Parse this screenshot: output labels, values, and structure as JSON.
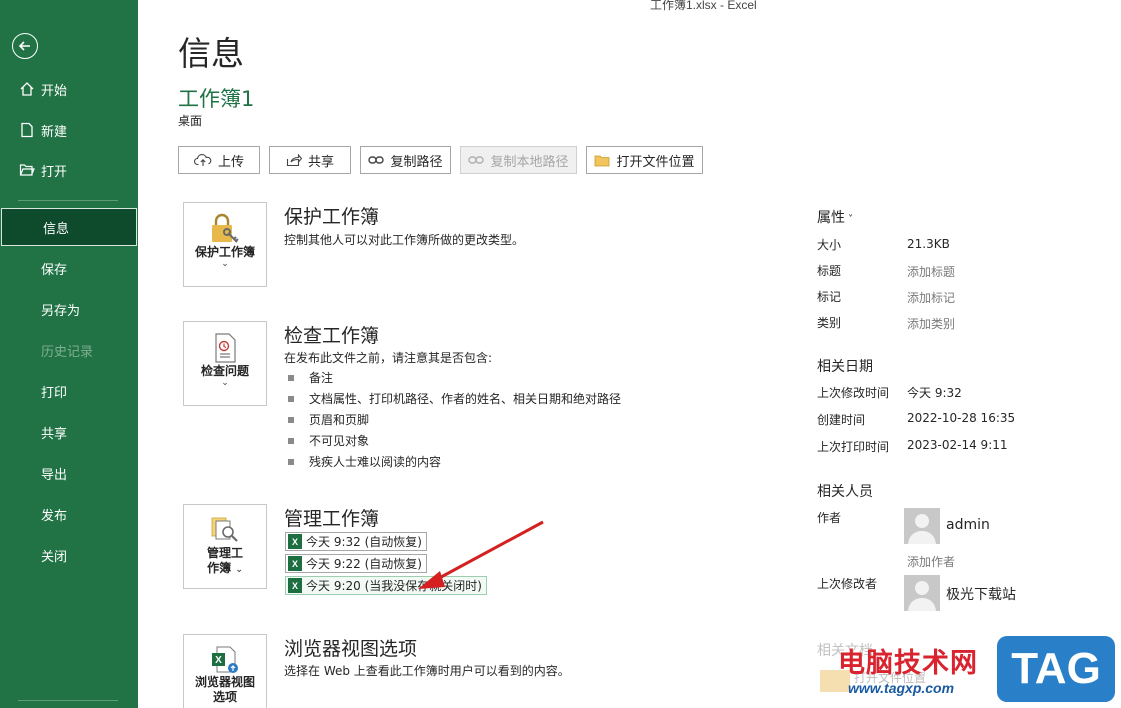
{
  "window": {
    "title": "工作簿1.xlsx  -  Excel"
  },
  "sidebar": {
    "items": [
      {
        "label": "开始",
        "icon": "home-icon"
      },
      {
        "label": "新建",
        "icon": "new-document-icon"
      },
      {
        "label": "打开",
        "icon": "open-folder-icon"
      },
      {
        "label": "信息",
        "active": true
      },
      {
        "label": "保存"
      },
      {
        "label": "另存为"
      },
      {
        "label": "历史记录",
        "disabled": true
      },
      {
        "label": "打印"
      },
      {
        "label": "共享"
      },
      {
        "label": "导出"
      },
      {
        "label": "发布"
      },
      {
        "label": "关闭"
      }
    ]
  },
  "page": {
    "title": "信息",
    "workbook_name": "工作簿1",
    "location": "桌面"
  },
  "actions": {
    "upload": "上传",
    "share": "共享",
    "copy_path": "复制路径",
    "copy_local_path": "复制本地路径",
    "open_location": "打开文件位置"
  },
  "protect": {
    "card_label": "保护工作簿",
    "title": "保护工作簿",
    "desc": "控制其他人可以对此工作簿所做的更改类型。"
  },
  "inspect": {
    "card_label": "检查问题",
    "title": "检查工作簿",
    "desc": "在发布此文件之前，请注意其是否包含:",
    "bullets": [
      "备注",
      "文档属性、打印机路径、作者的姓名、相关日期和绝对路径",
      "页眉和页脚",
      "不可见对象",
      "残疾人士难以阅读的内容"
    ]
  },
  "manage": {
    "card_label_1": "管理工",
    "card_label_2": "作簿",
    "title": "管理工作簿",
    "versions": [
      "今天 9:32 (自动恢复)",
      "今天 9:22 (自动恢复)",
      "今天 9:20 (当我没保存就关闭时)"
    ]
  },
  "browser": {
    "card_label_1": "浏览器视图",
    "card_label_2": "选项",
    "title": "浏览器视图选项",
    "desc": "选择在 Web 上查看此工作簿时用户可以看到的内容。"
  },
  "properties": {
    "heading": "属性",
    "rows": [
      {
        "label": "大小",
        "value": "21.3KB"
      },
      {
        "label": "标题",
        "value": "添加标题"
      },
      {
        "label": "标记",
        "value": "添加标记"
      },
      {
        "label": "类别",
        "value": "添加类别"
      }
    ],
    "dates_heading": "相关日期",
    "dates": [
      {
        "label": "上次修改时间",
        "value": "今天 9:32"
      },
      {
        "label": "创建时间",
        "value": "2022-10-28 16:35"
      },
      {
        "label": "上次打印时间",
        "value": "2023-02-14 9:11"
      }
    ],
    "people_heading": "相关人员",
    "author_label": "作者",
    "author": "admin",
    "add_author": "添加作者",
    "modifier_label": "上次修改者",
    "modifier": "极光下载站",
    "docs_heading": "相关文档",
    "open_location": "打开文件位置"
  },
  "watermark": {
    "text": "电脑技术网",
    "url": "www.tagxp.com",
    "tag": "TAG"
  },
  "colors": {
    "excel_green": "#217346",
    "active_nav": "#0e4a2c",
    "arrow_red": "#d42020"
  }
}
